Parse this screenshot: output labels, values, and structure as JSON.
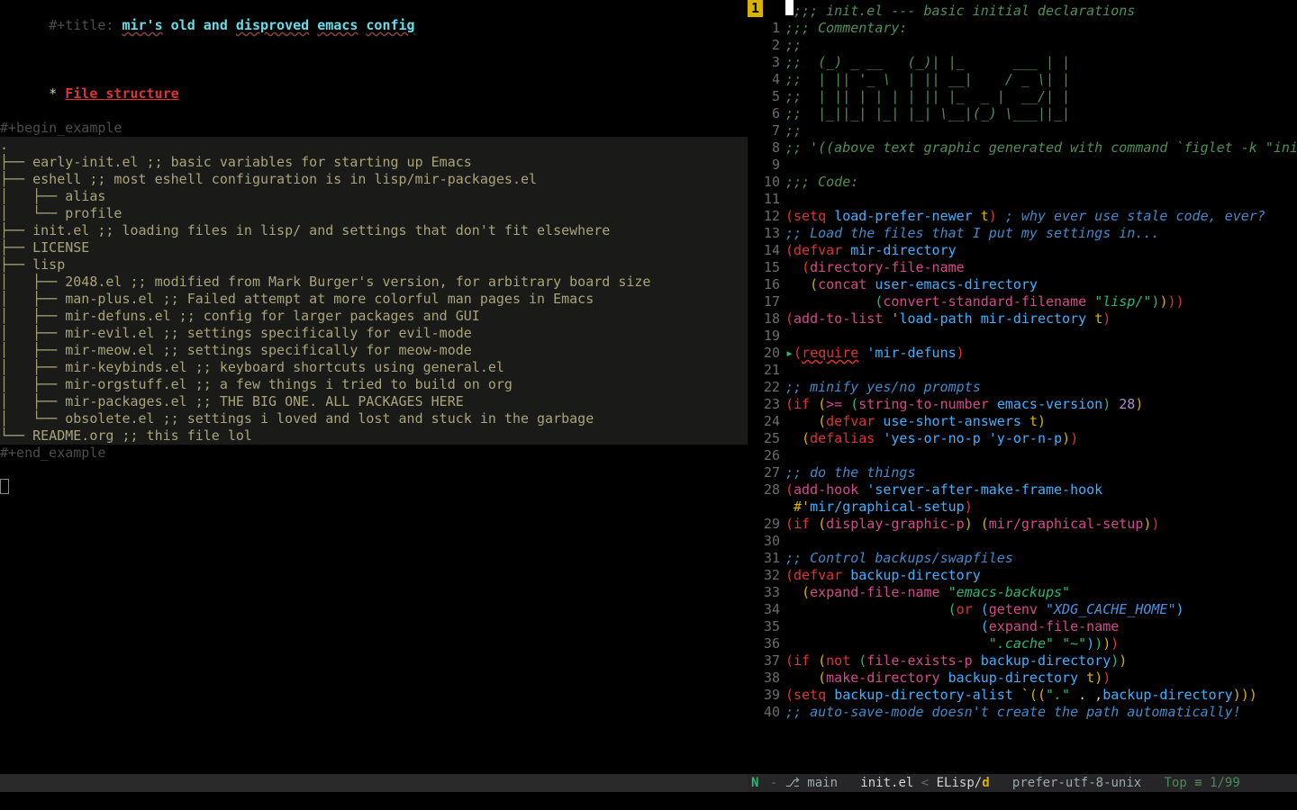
{
  "left": {
    "title_prefix": "#+title: ",
    "title_words": [
      "mir's",
      "old",
      "and",
      "disproved",
      "emacs",
      "config"
    ],
    "heading_star": "* ",
    "heading_text": "File structure",
    "begin": "#+begin_example",
    "tree": [
      ".",
      "├── early-init.el ;; basic variables for starting up Emacs",
      "├── eshell ;; most eshell configuration is in lisp/mir-packages.el",
      "│   ├── alias",
      "│   └── profile",
      "├── init.el ;; loading files in lisp/ and settings that don't fit elsewhere",
      "├── LICENSE",
      "├── lisp",
      "│   ├── 2048.el ;; modified from Mark Burger's version, for arbitrary board size",
      "│   ├── man-plus.el ;; Failed attempt at more colorful man pages in Emacs",
      "│   ├── mir-defuns.el ;; config for larger packages and GUI",
      "│   ├── mir-evil.el ;; settings specifically for evil-mode",
      "│   ├── mir-meow.el ;; settings specifically for meow-mode",
      "│   ├── mir-keybinds.el ;; keyboard shortcuts using general.el",
      "│   ├── mir-orgstuff.el ;; a few things i tried to build on org",
      "│   ├── mir-packages.el ;; THE BIG ONE. ALL PACKAGES HERE",
      "│   └── obsolete.el ;; settings i loved and lost and stuck in the garbage",
      "└── README.org ;; this file lol"
    ],
    "end": "#+end_example"
  },
  "right": {
    "current_header": "1",
    "lines": {
      "l0": ";;; init.el --- basic initial declarations",
      "c1": ";;; Commentary:",
      "c2": ";;",
      "a3": ";;  (_) _ __   (_)| |_      ___ | |",
      "a4": ";;  | || '_ \\  | || __|    / _ \\| |",
      "a5": ";;  | || | | | | || |_  _ |  __/| |",
      "a6": ";;  |_||_| |_| |_| \\__|(_) \\___||_|",
      "c7": ";;",
      "c8a": ";; '((above text graphic generated with command `figlet -k \"init.el\"'))",
      "c10": ";;; Code:",
      "l12": {
        "pre": "(",
        "kw": "setq",
        "sp": " ",
        "id": "load-prefer-newer",
        "sp2": " ",
        "t": "t",
        "post": ")",
        "cm": " ; why ever use stale code, ever?"
      },
      "l13": ";; Load the files that I put my settings in...",
      "l14": {
        "kw": "defvar",
        "id": "mir-directory"
      },
      "l15": {
        "fn": "directory-file-name"
      },
      "l16": {
        "fn": "concat",
        "id": "user-emacs-directory"
      },
      "l17": {
        "fn": "convert-standard-filename",
        "str": "\"lisp/\""
      },
      "l18": {
        "fn": "add-to-list",
        "q": "'",
        "sym": "load-path",
        "id": "mir-directory",
        "t": "t"
      },
      "l20": {
        "req": "require",
        "sym": "'mir-defuns"
      },
      "l22": ";; minify yes/no prompts",
      "l23": {
        "if": "if",
        "ge": ">=",
        "fn": "string-to-number",
        "id": "emacs-version",
        "num": "28"
      },
      "l24": {
        "kw": "defvar",
        "id": "use-short-answers",
        "t": "t"
      },
      "l25": {
        "kw": "defalias",
        "s1": "'yes-or-no-p",
        "s2": "'y-or-n-p"
      },
      "l27": ";; do the things",
      "l28": {
        "fn": "add-hook",
        "sym": "'server-after-make-frame-hook"
      },
      "l28b": {
        "hp": "#'",
        "sym": "mir/graphical-setup"
      },
      "l29": {
        "if": "if",
        "fn": "display-graphic-p",
        "fn2": "mir/graphical-setup"
      },
      "l31": ";; Control backups/swapfiles",
      "l32": {
        "kw": "defvar",
        "id": "backup-directory"
      },
      "l33": {
        "fn": "expand-file-name",
        "str": "\"emacs-backups\""
      },
      "l34": {
        "or": "or",
        "fn": "getenv",
        "str": "\"XDG_CACHE_HOME\""
      },
      "l35": {
        "fn": "expand-file-name"
      },
      "l36": {
        "s1": "\".cache\"",
        "s2": "\"~\""
      },
      "l37": {
        "if": "if",
        "not": "not",
        "fn": "file-exists-p",
        "id": "backup-directory"
      },
      "l38": {
        "fn": "make-directory",
        "id": "backup-directory",
        "t": "t"
      },
      "l39": {
        "kw": "setq",
        "id": "backup-directory-alist",
        "bq": "`((",
        "s": "\".\"",
        "dot": " . ,",
        "id2": "backup-directory",
        "post": ")))"
      },
      "l40": ";; auto-save-mode doesn't create the path automatically!"
    }
  },
  "modeline": {
    "state": "N",
    "dash": " - ",
    "branch_icon": "⎇",
    "branch": " main ",
    "file": "  init.el ",
    "lt": "< ",
    "mode": "ELisp/",
    "mode_suffix": "d",
    "coding": "   prefer-utf-8-unix   ",
    "pos": "Top ≡ 1/99 "
  }
}
